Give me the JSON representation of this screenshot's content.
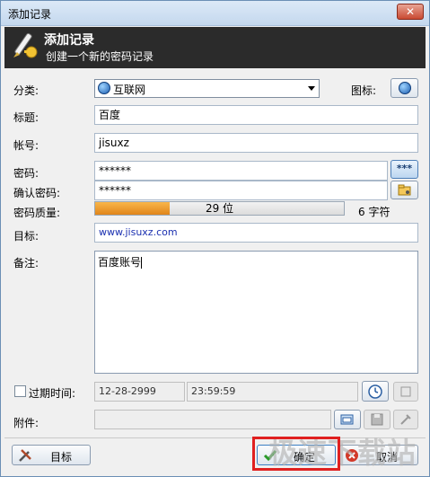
{
  "window": {
    "title": "添加记录"
  },
  "banner": {
    "title": "添加记录",
    "subtitle": "创建一个新的密码记录"
  },
  "form": {
    "category_label": "分类:",
    "category_value": "互联网",
    "icon_label": "图标:",
    "title_label": "标题:",
    "title_value": "百度",
    "account_label": "帐号:",
    "account_value": "jisuxz",
    "password_label": "密码:",
    "password_value": "******",
    "confirm_label": "确认密码:",
    "confirm_value": "******",
    "show_pw_button": "***",
    "quality_label": "密码质量:",
    "quality_bits": "29 位",
    "quality_fraction": 0.3,
    "quality_chars": "6 字符",
    "target_label": "目标:",
    "target_value": "www.jisuxz.com",
    "notes_label": "备注:",
    "notes_value": "百度账号",
    "expire_label": "过期时间:",
    "expire_date": "12-28-2999",
    "expire_time": "23:59:59",
    "attachment_label": "附件:"
  },
  "footer": {
    "tools_button": "目标",
    "ok_button": "确定",
    "cancel_button": "取消",
    "watermark": "极速下载站"
  }
}
